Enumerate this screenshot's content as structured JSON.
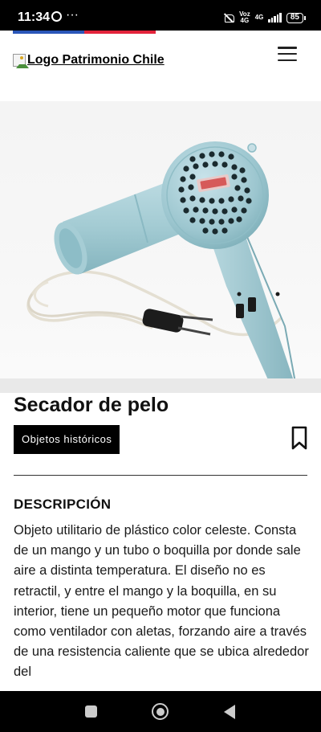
{
  "status_bar": {
    "time": "11:34",
    "dots": "···",
    "network_top": "Voz",
    "network_bottom": "4G",
    "network2_top": "4G",
    "battery": "85"
  },
  "header": {
    "logo_alt": "Logo Patrimonio Chile",
    "colors": {
      "flag_blue": "#2a56b8",
      "flag_red": "#e3243b"
    }
  },
  "object": {
    "title": "Secador de pelo",
    "category_tag": "Objetos históricos"
  },
  "description": {
    "heading": "DESCRIPCIÓN",
    "text": "Objeto utilitario de plástico color celeste. Consta de un mango y un tubo o boquilla por donde sale aire a distinta temperatura. El diseño no es retractil, y entre el mango y la boquilla, en su interior, tiene un pequeño motor que funciona como ventilador con aletas, forzando aire a través de una resistencia caliente que se ubica alrededor del"
  },
  "icons": {
    "menu": "hamburger-menu-icon",
    "bookmark": "bookmark-icon",
    "nav_recents": "square-icon",
    "nav_home": "circle-icon",
    "nav_back": "triangle-back-icon"
  }
}
